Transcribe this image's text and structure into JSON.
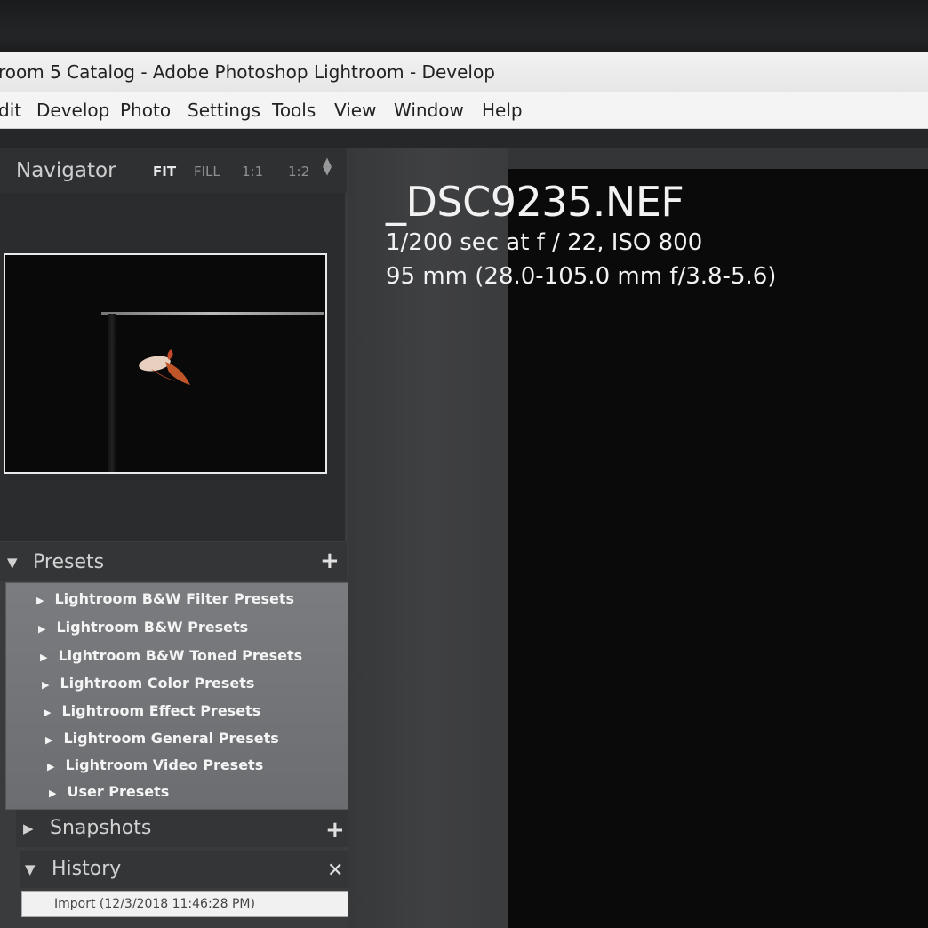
{
  "window": {
    "title": "room 5 Catalog - Adobe Photoshop Lightroom - Develop"
  },
  "menu": [
    "dit",
    "Develop",
    "Photo",
    "Settings",
    "Tools",
    "View",
    "Window",
    "Help"
  ],
  "navigator": {
    "title": "Navigator",
    "zoom_options": [
      "FIT",
      "FILL",
      "1:1",
      "1:2"
    ],
    "active_zoom": "FIT"
  },
  "presets": {
    "title": "Presets",
    "items": [
      "Lightroom B&W Filter Presets",
      "Lightroom B&W Presets",
      "Lightroom B&W Toned Presets",
      "Lightroom Color Presets",
      "Lightroom Effect Presets",
      "Lightroom General Presets",
      "Lightroom Video Presets",
      "User Presets"
    ]
  },
  "snapshots": {
    "title": "Snapshots"
  },
  "history": {
    "title": "History",
    "items": [
      "Import (12/3/2018 11:46:28 PM)"
    ]
  },
  "photo_info": {
    "filename": "_DSC9235.NEF",
    "exposure": "1/200 sec at f / 22, ISO 800",
    "lens": "95 mm (28.0-105.0 mm f/3.8-5.6)"
  },
  "icons": {
    "expanded": "triangle-down-icon",
    "collapsed": "triangle-right-icon",
    "add": "plus-icon",
    "close": "close-icon"
  }
}
